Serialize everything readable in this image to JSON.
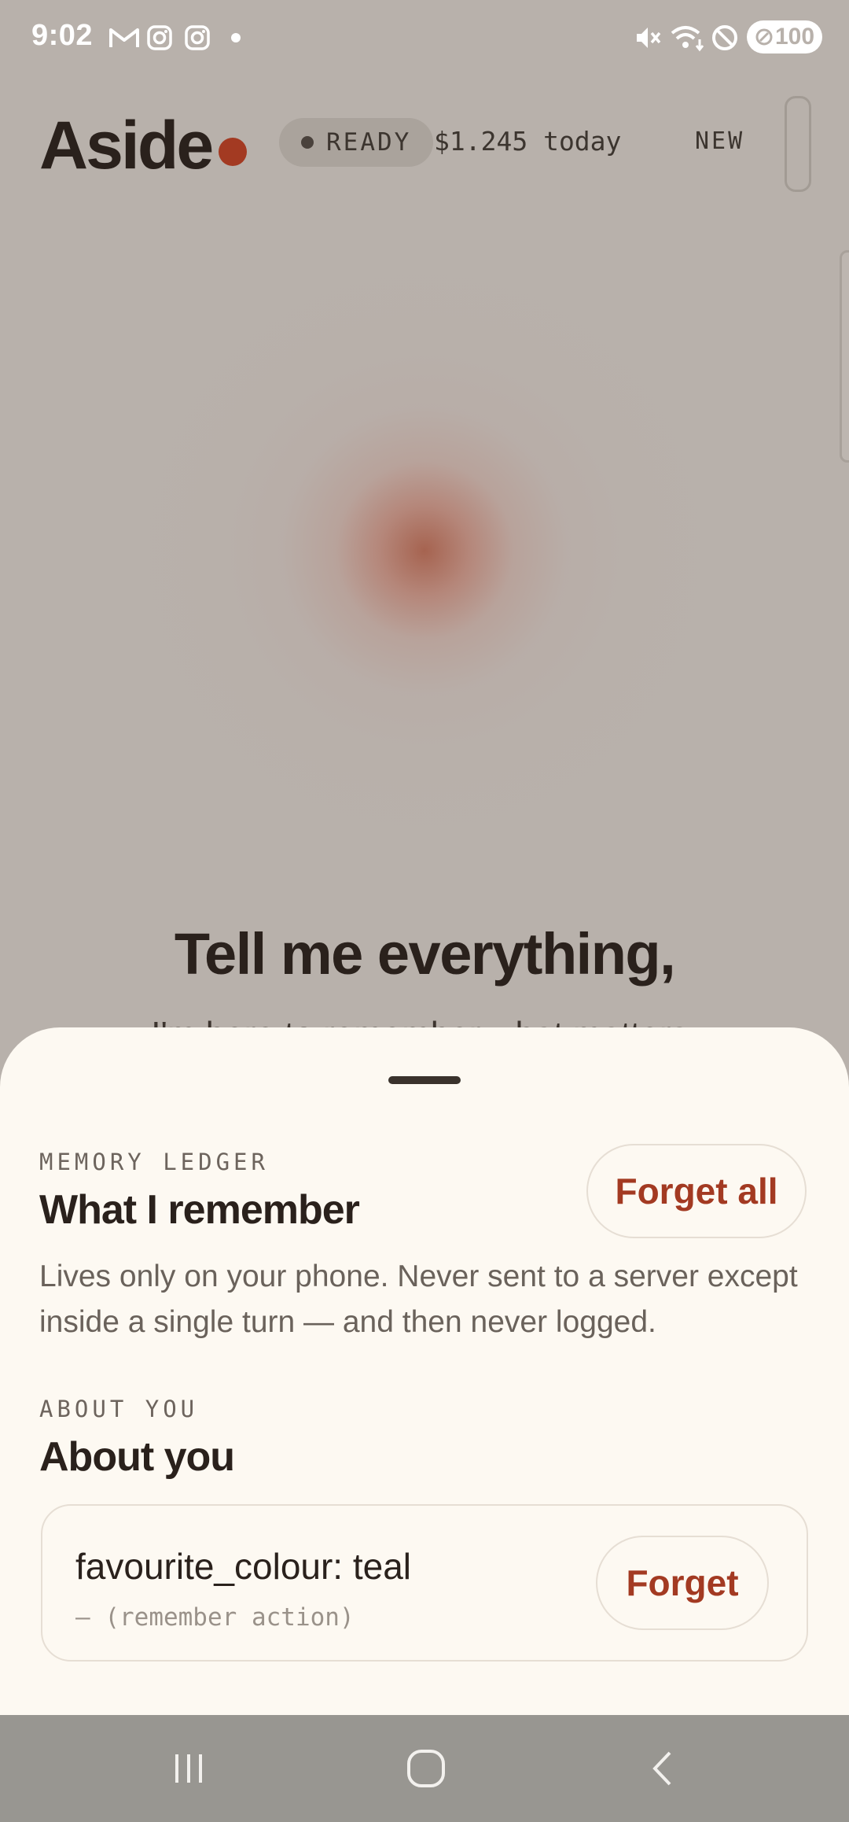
{
  "status_bar": {
    "time": "9:02",
    "battery": "100",
    "left_icons": [
      "gmail-icon",
      "instagram-icon",
      "instagram-icon",
      "notification-dot-icon"
    ],
    "right_icons": [
      "mute-icon",
      "wifi-icon",
      "do-not-disturb-icon",
      "battery-icon"
    ]
  },
  "header": {
    "title": "Aside",
    "status": "READY",
    "cost": "$1.245 today",
    "new_label": "NEW",
    "accent_color": "#a33a22"
  },
  "main": {
    "headline": "Tell me everything,",
    "subheadline": "I'm here to remember what matters."
  },
  "sheet": {
    "eyebrow": "MEMORY LEDGER",
    "title": "What I remember",
    "forget_all_label": "Forget all",
    "description": "Lives only on your phone. Never sent to a server except inside a single turn — and then never logged.",
    "section_eyebrow": "ABOUT YOU",
    "section_title": "About you",
    "memories": [
      {
        "key": "favourite_colour: teal",
        "source": "— (remember action)",
        "forget_label": "Forget"
      }
    ]
  },
  "nav_bar": {
    "icons": [
      "recent-apps-icon",
      "home-icon",
      "back-icon"
    ]
  }
}
